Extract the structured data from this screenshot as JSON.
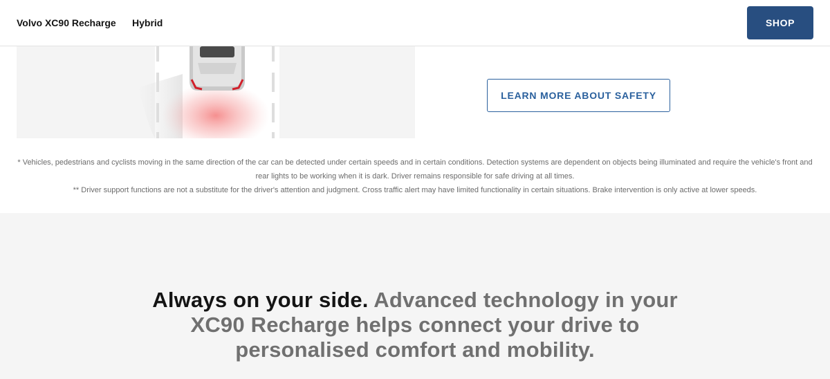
{
  "header": {
    "model_name": "Volvo XC90 Recharge",
    "variant": "Hybrid",
    "shop_label": "SHOP"
  },
  "safety": {
    "image_icon": "car-top-view-rear-sensor-icon",
    "cta_label": "LEARN MORE ABOUT SAFETY"
  },
  "disclaimers": [
    "* Vehicles, pedestrians and cyclists moving in the same direction of the car can be detected under certain speeds and in certain conditions. Detection systems are dependent on objects being illuminated and require the vehicle's front and rear lights to be working when it is dark. Driver remains responsible for safe driving at all times.",
    "** Driver support functions are not a substitute for the driver's attention and judgment. Cross traffic alert may have limited functionality in certain situations. Brake intervention is only active at lower speeds."
  ],
  "comfort": {
    "headline_lead": "Always on your side.",
    "headline_rest": "Advanced technology in your XC90 Recharge helps connect your drive to personalised comfort and mobility."
  },
  "colors": {
    "shop_button": "#284e80",
    "cta_outline": "#2a609d",
    "section_background": "#f5f5f5",
    "headline_secondary": "#707070"
  }
}
